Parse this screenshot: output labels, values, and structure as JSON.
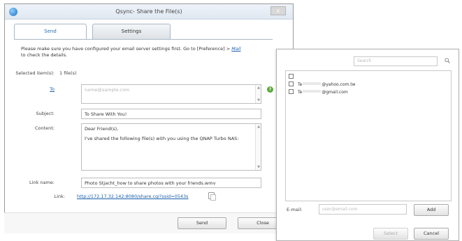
{
  "window": {
    "title": "Qsync- Share the File(s)",
    "close_glyph": "x"
  },
  "tabs": [
    {
      "label": "Send"
    },
    {
      "label": "Settings"
    }
  ],
  "notice": {
    "text": "Please make sure you have configured your email server settings first. Go to [Preference] >",
    "link": "Mail",
    "suffix": "to check the details."
  },
  "form": {
    "selected_label": "Selected item(s):",
    "selected_value": "1 file(s)",
    "to_label": "To",
    "to_placeholder": "name@sample.com",
    "subject_label": "Subject:",
    "subject_value": "To Share With You!",
    "content_label": "Content:",
    "content_line1": "Dear Friend(s),",
    "content_line2": "I've shared the following file(s) with you using the QNAP Turbo NAS:",
    "linkname_label": "Link name:",
    "linkname_value": "Photo Stjacht_how to share photos with your friends.wmv",
    "link_label": "Link:",
    "link_value": "http://172.17.32.142:8080/share.cgi?ssid=0543s"
  },
  "footer": {
    "send": "Send",
    "close": "Close"
  },
  "picker": {
    "search_placeholder": "Search",
    "contacts": [
      {
        "prefix": "",
        "suffix": ""
      },
      {
        "prefix": "Te",
        "suffix": "@yahoo.com.tw"
      },
      {
        "prefix": "Te",
        "suffix": "@gmail.com"
      }
    ],
    "email_label": "E-mail:",
    "email_placeholder": "user@email.com",
    "add": "Add",
    "select": "Select",
    "cancel": "Cancel"
  },
  "colors": {
    "link": "#1a5ea8",
    "help_green": "#5aa83a",
    "tab_active_text": "#2b6fb5"
  }
}
